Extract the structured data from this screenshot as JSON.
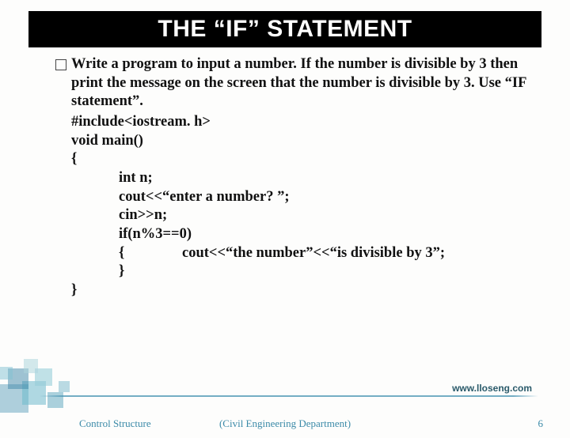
{
  "title": "THE “IF” STATEMENT",
  "description": "Write a program to input a number. If the number is divisible by 3 then print the message on the screen that the number is divisible by 3. Use “IF statement”.",
  "code": {
    "l1": "#include<iostream. h>",
    "l2": "void main()",
    "l3": "{",
    "l4": "int n;",
    "l5": "cout<<“enter a number? ”;",
    "l6": "cin>>n;",
    "l7": "if(n%3==0)",
    "l8_brace": "{",
    "l8_body": "cout<<“the number”<<“is divisible by 3”;",
    "l9": "}",
    "l10": "}"
  },
  "link": "www.lloseng.com",
  "footer": {
    "left": "Control Structure",
    "center": "(Civil Engineering Department)",
    "right": "6"
  }
}
